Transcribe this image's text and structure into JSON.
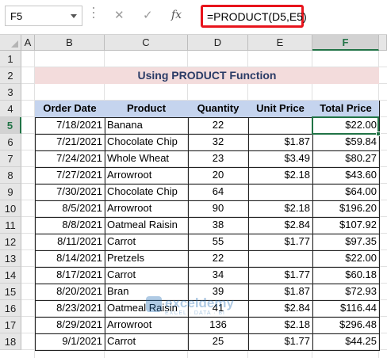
{
  "formula_bar": {
    "name_box": "F5",
    "cancel_glyph": "✕",
    "enter_glyph": "✓",
    "fx_label": "fx",
    "formula": "=PRODUCT(D5,E5)"
  },
  "columns": [
    "A",
    "B",
    "C",
    "D",
    "E",
    "F"
  ],
  "selected_column": "F",
  "rows": [
    "1",
    "2",
    "3",
    "4",
    "5",
    "6",
    "7",
    "8",
    "9",
    "10",
    "11",
    "12",
    "13",
    "14",
    "15",
    "16",
    "17",
    "18"
  ],
  "selected_row": "5",
  "title": "Using PRODUCT Function",
  "table": {
    "headers": [
      "Order Date",
      "Product",
      "Quantity",
      "Unit Price",
      "Total Price"
    ],
    "rows": [
      [
        "7/18/2021",
        "Banana",
        "22",
        "",
        "$22.00"
      ],
      [
        "7/21/2021",
        "Chocolate Chip",
        "32",
        "$1.87",
        "$59.84"
      ],
      [
        "7/24/2021",
        "Whole Wheat",
        "23",
        "$3.49",
        "$80.27"
      ],
      [
        "7/27/2021",
        "Arrowroot",
        "20",
        "$2.18",
        "$43.60"
      ],
      [
        "7/30/2021",
        "Chocolate Chip",
        "64",
        "",
        "$64.00"
      ],
      [
        "8/5/2021",
        "Arrowroot",
        "90",
        "$2.18",
        "$196.20"
      ],
      [
        "8/8/2021",
        "Oatmeal Raisin",
        "38",
        "$2.84",
        "$107.92"
      ],
      [
        "8/11/2021",
        "Carrot",
        "55",
        "$1.77",
        "$97.35"
      ],
      [
        "8/14/2021",
        "Pretzels",
        "22",
        "",
        "$22.00"
      ],
      [
        "8/17/2021",
        "Carrot",
        "34",
        "$1.77",
        "$60.18"
      ],
      [
        "8/20/2021",
        "Bran",
        "39",
        "$1.87",
        "$72.93"
      ],
      [
        "8/23/2021",
        "Oatmeal Raisin",
        "41",
        "$2.84",
        "$116.44"
      ],
      [
        "8/29/2021",
        "Arrowroot",
        "136",
        "$2.18",
        "$296.48"
      ],
      [
        "9/1/2021",
        "Carrot",
        "25",
        "$1.77",
        "$44.25"
      ]
    ]
  },
  "watermark": {
    "brand": "exceldemy",
    "tagline": "EXCEL · DATA · BI"
  }
}
